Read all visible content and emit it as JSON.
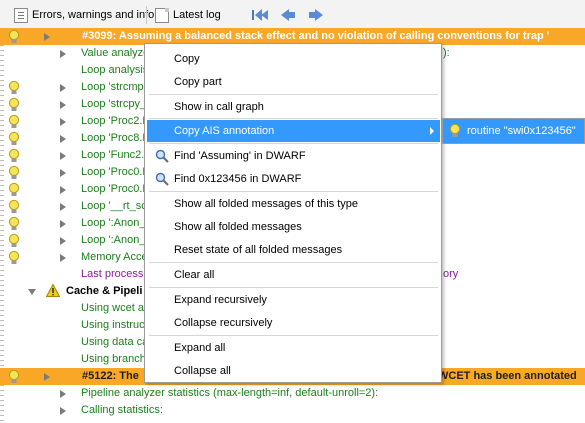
{
  "toolbar": {
    "errors_label": "Errors, warnings and info",
    "log_label": "Latest log"
  },
  "tree": {
    "rows": [
      {
        "bulb": true,
        "arrow": "right",
        "text": "#3099: Assuming a balanced stack effect and no violation of calling conventions for trap '",
        "style": "white",
        "hl": true
      },
      {
        "bulb": false,
        "arrow": "right",
        "text": "Value analyzer",
        "tail": "):",
        "style": "green"
      },
      {
        "bulb": false,
        "arrow": "",
        "text": "Loop analysis",
        "style": "green"
      },
      {
        "bulb": true,
        "arrow": "right",
        "text": "Loop 'strcmp",
        "style": "green"
      },
      {
        "bulb": true,
        "arrow": "right",
        "text": "Loop 'strcpy_",
        "style": "green"
      },
      {
        "bulb": true,
        "arrow": "right",
        "text": "Loop 'Proc2.L",
        "style": "green"
      },
      {
        "bulb": true,
        "arrow": "right",
        "text": "Loop 'Proc8.L",
        "style": "green"
      },
      {
        "bulb": true,
        "arrow": "right",
        "text": "Loop 'Func2.L",
        "style": "green"
      },
      {
        "bulb": true,
        "arrow": "right",
        "text": "Loop 'Proc0.L",
        "style": "green"
      },
      {
        "bulb": true,
        "arrow": "right",
        "text": "Loop 'Proc0.L",
        "style": "green"
      },
      {
        "bulb": true,
        "arrow": "right",
        "text": "Loop '__rt_sc",
        "style": "green"
      },
      {
        "bulb": true,
        "arrow": "right",
        "text": "Loop ':Anon_",
        "style": "green"
      },
      {
        "bulb": true,
        "arrow": "right",
        "text": "Loop ':Anon_",
        "style": "green"
      },
      {
        "bulb": true,
        "arrow": "right",
        "text": "Memory Acce",
        "style": "green"
      },
      {
        "bulb": false,
        "arrow": "",
        "text": "Last process",
        "tail": "ory",
        "style": "purple"
      },
      {
        "bulb": false,
        "arrow": "down",
        "text": "Cache & Pipeli",
        "style": "bold",
        "warn": true
      },
      {
        "bulb": false,
        "arrow": "",
        "text": "Using wcet ar",
        "style": "green"
      },
      {
        "bulb": false,
        "arrow": "",
        "text": "Using instruct",
        "style": "green"
      },
      {
        "bulb": false,
        "arrow": "",
        "text": "Using data ca",
        "style": "green"
      },
      {
        "bulb": false,
        "arrow": "",
        "text": "Using branch",
        "style": "green"
      },
      {
        "bulb": true,
        "arrow": "right",
        "text": "#5122: The",
        "tail": "WCET has been annotated",
        "style": "dark",
        "hl": true
      },
      {
        "bulb": false,
        "arrow": "right",
        "text": "Pipeline analyzer statistics (max-length=inf, default-unroll=2):",
        "style": "green"
      },
      {
        "bulb": false,
        "arrow": "right",
        "text": "Calling statistics:",
        "style": "green"
      }
    ]
  },
  "menu": {
    "copy": "Copy",
    "copy_part": "Copy part",
    "show_call_graph": "Show in call graph",
    "copy_ais": "Copy AIS annotation",
    "find_assuming": "Find 'Assuming' in DWARF",
    "find_addr": "Find 0x123456 in DWARF",
    "show_folded_type": "Show all folded messages of this type",
    "show_folded_all": "Show all folded messages",
    "reset_folded": "Reset state of all folded messages",
    "clear_all": "Clear all",
    "expand_rec": "Expand recursively",
    "collapse_rec": "Collapse recursively",
    "expand_all": "Expand all",
    "collapse_all": "Collapse all"
  },
  "submenu": {
    "routine": "routine \"swi0x123456\""
  },
  "colors": {
    "highlight_row": "#f8a726",
    "menu_selection": "#3399ff",
    "green_text": "#1a7f1a",
    "purple_text": "#8b1c9e"
  }
}
